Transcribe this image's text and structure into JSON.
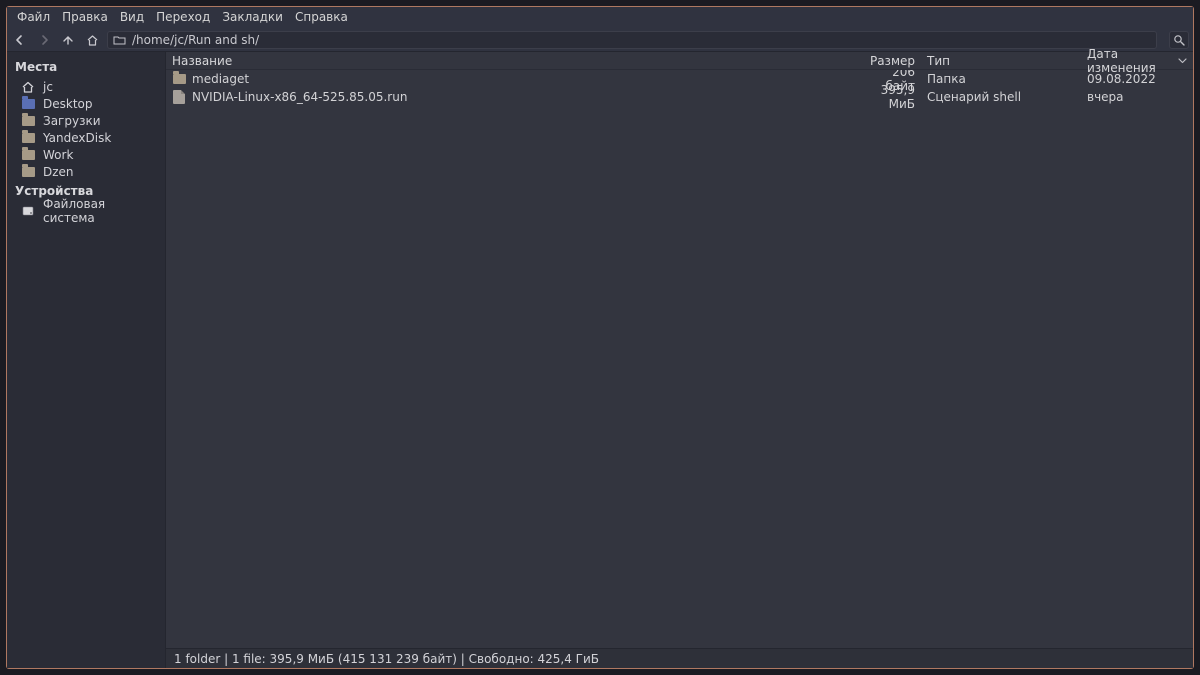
{
  "menu": [
    "Файл",
    "Правка",
    "Вид",
    "Переход",
    "Закладки",
    "Справка"
  ],
  "path": "/home/jc/Run and sh/",
  "sidebar": {
    "places_header": "Места",
    "places": [
      {
        "icon": "home",
        "label": "jc"
      },
      {
        "icon": "folder-blue",
        "label": "Desktop"
      },
      {
        "icon": "folder",
        "label": "Загрузки"
      },
      {
        "icon": "folder",
        "label": "YandexDisk"
      },
      {
        "icon": "folder",
        "label": "Work"
      },
      {
        "icon": "folder",
        "label": "Dzen"
      }
    ],
    "devices_header": "Устройства",
    "devices": [
      {
        "icon": "disk",
        "label": "Файловая система"
      }
    ]
  },
  "columns": {
    "name": "Название",
    "size": "Размер",
    "type": "Тип",
    "date": "Дата изменения"
  },
  "rows": [
    {
      "icon": "folder",
      "name": "mediaget",
      "size": "206 байт",
      "type": "Папка",
      "date": "09.08.2022"
    },
    {
      "icon": "file",
      "name": "NVIDIA-Linux-x86_64-525.85.05.run",
      "size": "395,9 МиБ",
      "type": "Сценарий shell",
      "date": "вчера"
    }
  ],
  "status": "1 folder  |  1 file: 395,9 МиБ (415 131 239 байт)  |  Свободно: 425,4 ГиБ"
}
